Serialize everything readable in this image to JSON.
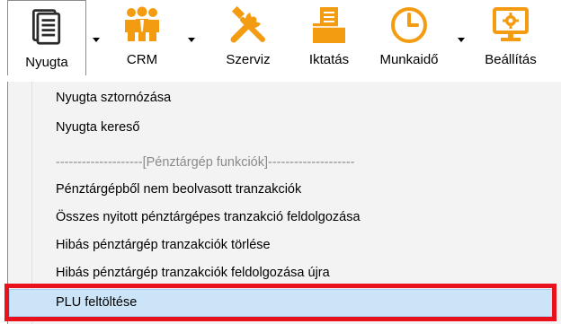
{
  "toolbar": {
    "buttons": [
      {
        "label": "Nyugta",
        "icon": "receipt-icon",
        "active": true,
        "has_dropdown": true
      },
      {
        "label": "CRM",
        "icon": "people-icon",
        "active": false,
        "has_dropdown": true
      },
      {
        "label": "Szerviz",
        "icon": "tools-icon",
        "active": false,
        "has_dropdown": false
      },
      {
        "label": "Iktatás",
        "icon": "folder-icon",
        "active": false,
        "has_dropdown": false
      },
      {
        "label": "Munkaidő",
        "icon": "clock-icon",
        "active": false,
        "has_dropdown": true
      },
      {
        "label": "Beállítás",
        "icon": "monitor-gear-icon",
        "active": false,
        "has_dropdown": false
      }
    ]
  },
  "menu": {
    "items": [
      {
        "label": "Nyugta sztornózása",
        "type": "item"
      },
      {
        "label": "Nyugta kereső",
        "type": "item"
      },
      {
        "label": "--------------------[Pénztárgép funkciók]--------------------",
        "type": "separator"
      },
      {
        "label": "Pénztárgépből nem beolvasott tranzakciók",
        "type": "item"
      },
      {
        "label": "Összes nyitott pénztárgépes tranzakció feldolgozása",
        "type": "item"
      },
      {
        "label": "Hibás pénztárgép tranzakciók törlése",
        "type": "item"
      },
      {
        "label": "Hibás pénztárgép tranzakciók feldolgozása újra",
        "type": "item",
        "partially_hidden": true
      },
      {
        "label": "PLU feltöltése",
        "type": "item",
        "highlighted": true
      }
    ]
  },
  "colors": {
    "icon_orange": "#f39c12",
    "icon_dark": "#2b2b2b",
    "highlight_border": "#e8111c",
    "menu_hover": "#cce4f7",
    "menu_bg": "#f3f3f3",
    "separator_text": "#8a8a8a"
  }
}
